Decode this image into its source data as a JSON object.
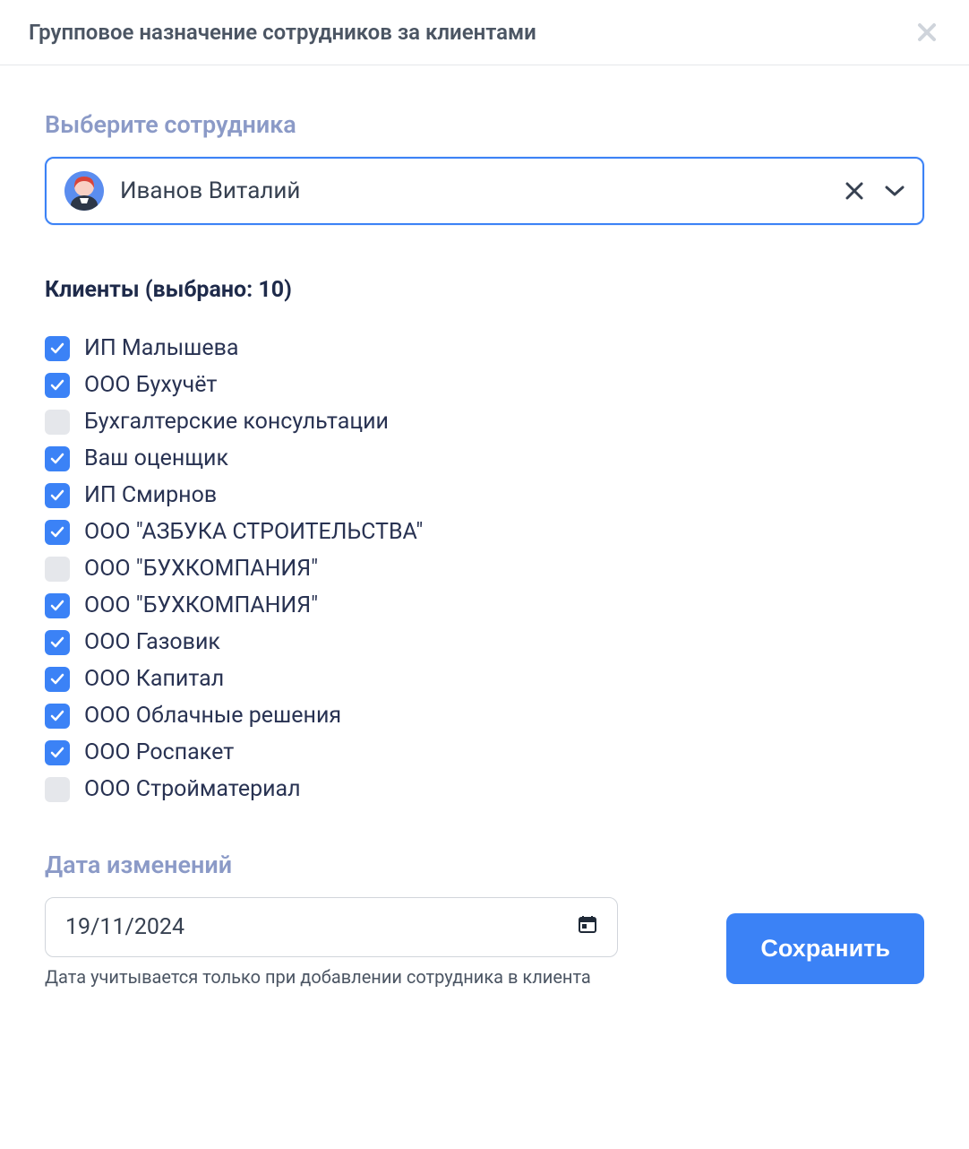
{
  "header": {
    "title": "Групповое назначение сотрудников за клиентами"
  },
  "employee": {
    "label": "Выберите сотрудника",
    "selected": "Иванов Виталий"
  },
  "clients": {
    "heading": "Клиенты (выбрано: 10)",
    "items": [
      {
        "label": "ИП Малышева",
        "checked": true
      },
      {
        "label": "ООО Бухучёт",
        "checked": true
      },
      {
        "label": "Бухгалтерские консультации",
        "checked": false
      },
      {
        "label": "Ваш оценщик",
        "checked": true
      },
      {
        "label": "ИП Смирнов",
        "checked": true
      },
      {
        "label": "ООО \"АЗБУКА СТРОИТЕЛЬСТВА\"",
        "checked": true
      },
      {
        "label": "ООО \"БУХКОМПАНИЯ\"",
        "checked": false
      },
      {
        "label": "ООО \"БУХКОМПАНИЯ\"",
        "checked": true
      },
      {
        "label": "ООО Газовик",
        "checked": true
      },
      {
        "label": "ООО Капитал",
        "checked": true
      },
      {
        "label": "ООО Облачные решения",
        "checked": true
      },
      {
        "label": "ООО Роспакет",
        "checked": true
      },
      {
        "label": "ООО Стройматериал",
        "checked": false
      }
    ]
  },
  "date": {
    "label": "Дата изменений",
    "value": "19/11/2024",
    "hint": "Дата учитывается только при добавлении сотрудника в клиента"
  },
  "actions": {
    "save": "Сохранить"
  }
}
